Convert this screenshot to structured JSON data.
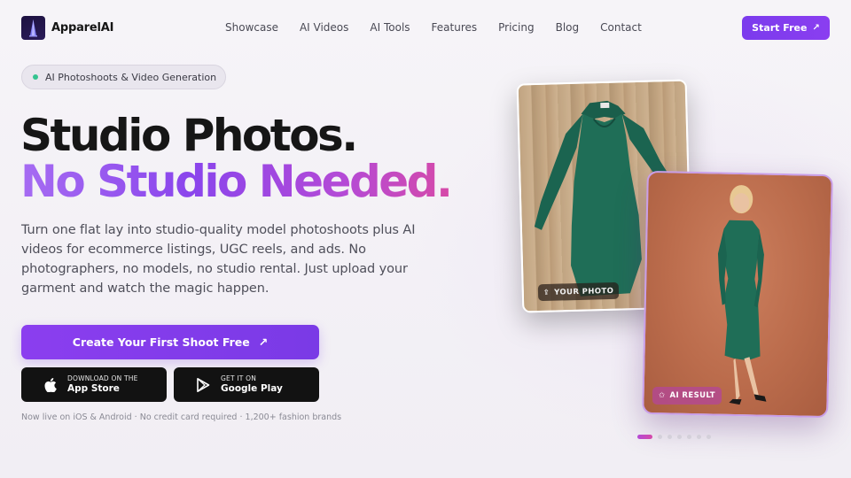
{
  "brand": {
    "name": "ApparelAI",
    "logo_icon": "tower-logo-icon"
  },
  "nav": {
    "items": [
      {
        "label": "Showcase"
      },
      {
        "label": "AI Videos"
      },
      {
        "label": "AI Tools"
      },
      {
        "label": "Features"
      },
      {
        "label": "Pricing"
      },
      {
        "label": "Blog"
      },
      {
        "label": "Contact"
      }
    ],
    "cta_label": "Start Free"
  },
  "hero": {
    "badge": "AI Photoshoots & Video Generation",
    "title_line1": "Studio Photos.",
    "title_line2": "No Studio Needed.",
    "description": "Turn one flat lay into studio-quality model photoshoots plus AI videos for ecommerce listings, UGC reels, and ads. No photographers, no models, no studio rental. Just upload your garment and watch the magic happen.",
    "cta_label": "Create Your First Shoot Free",
    "app_store": {
      "small": "DOWNLOAD ON THE",
      "big": "App Store"
    },
    "google_play": {
      "small": "GET IT ON",
      "big": "Google Play"
    },
    "note": "Now live on iOS & Android · No credit card required · 1,200+ fashion brands"
  },
  "showcase": {
    "before_label": "YOUR PHOTO",
    "after_label": "AI RESULT",
    "carousel": {
      "total": 7,
      "active": 1
    }
  },
  "colors": {
    "accent": "#7c3aed",
    "gradient_end": "#d64aa8",
    "dress": "#1f6b56",
    "backdrop": "#c07556"
  }
}
